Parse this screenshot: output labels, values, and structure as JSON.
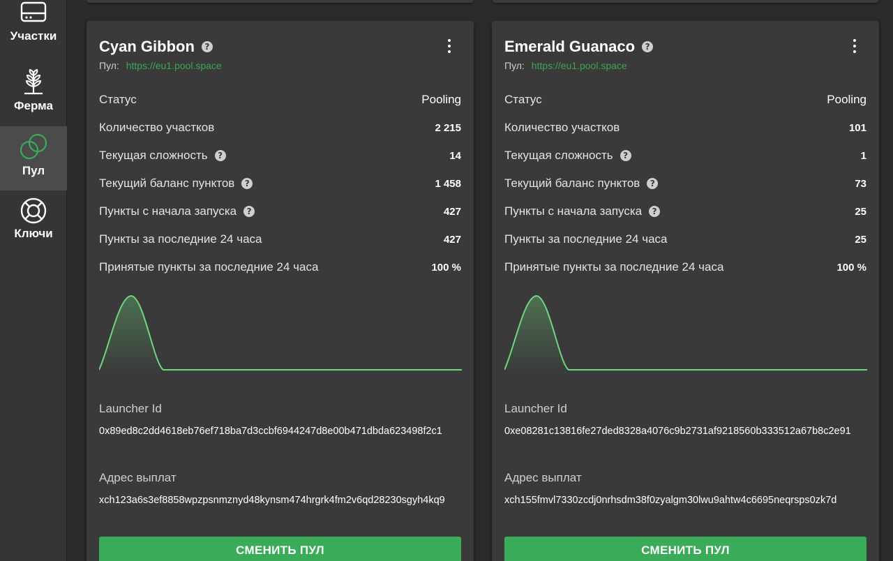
{
  "sidebar": {
    "items": [
      {
        "label": "Участки",
        "icon": "hard-drive-icon"
      },
      {
        "label": "Ферма",
        "icon": "plant-icon"
      },
      {
        "label": "Пул",
        "icon": "pool-rings-icon",
        "active": true
      },
      {
        "label": "Ключи",
        "icon": "lifebuoy-icon"
      }
    ]
  },
  "cards": [
    {
      "name": "Cyan Gibbon",
      "pool_prefix": "Пул:",
      "pool_url": "https://eu1.pool.space",
      "rows": [
        {
          "label": "Статус",
          "value": "Pooling"
        },
        {
          "label": "Количество участков",
          "value": "2 215"
        },
        {
          "label": "Текущая сложность",
          "value": "14"
        },
        {
          "label": "Текущий баланс пунктов",
          "value": "1 458"
        },
        {
          "label": "Пункты с начала запуска",
          "value": "427"
        },
        {
          "label": "Пункты за последние 24 часа",
          "value": "427"
        },
        {
          "label": "Принятые пункты за последние 24 часа",
          "value": "100 %"
        }
      ],
      "launcher_label": "Launcher Id",
      "launcher_id": "0x89ed8c2dd4618eb76ef718ba7d3ccbf6944247d8e00b471dbda623498f2c1",
      "payout_label": "Адрес выплат",
      "payout_address": "xch123a6s3ef8858wpzpsnmznyd48kynsm474hrgrk4fm2v6qd28230sgyh4kq9",
      "button_label": "СМЕНИТЬ ПУЛ"
    },
    {
      "name": "Emerald Guanaco",
      "pool_prefix": "Пул:",
      "pool_url": "https://eu1.pool.space",
      "rows": [
        {
          "label": "Статус",
          "value": "Pooling"
        },
        {
          "label": "Количество участков",
          "value": "101"
        },
        {
          "label": "Текущая сложность",
          "value": "1"
        },
        {
          "label": "Текущий баланс пунктов",
          "value": "73"
        },
        {
          "label": "Пункты с начала запуска",
          "value": "25"
        },
        {
          "label": "Пункты за последние 24 часа",
          "value": "25"
        },
        {
          "label": "Принятые пункты за последние 24 часа",
          "value": "100 %"
        }
      ],
      "launcher_label": "Launcher Id",
      "launcher_id": "0xe08281c13816fe27ded8328a4076c9b2731af9218560b333512a67b8c2e91",
      "payout_label": "Адрес выплат",
      "payout_address": "xch155fmvl7330zcdj0nrhsdm38f0zyalgm30lwu9ahtw4c6695neqrsps0zk7d",
      "button_label": "СМЕНИТЬ ПУЛ"
    }
  ],
  "colors": {
    "accent": "#3aab58",
    "link": "#3aa556",
    "chart_line": "#6fd67f"
  }
}
